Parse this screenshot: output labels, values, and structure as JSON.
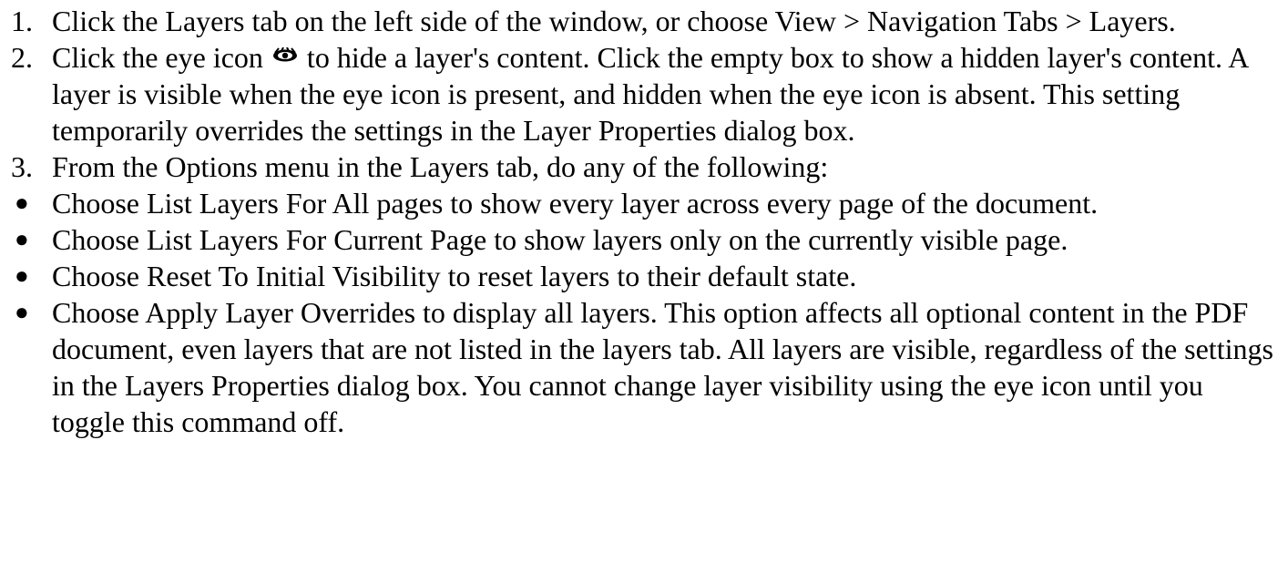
{
  "steps": [
    {
      "number": "1.",
      "text": "Click the Layers tab on the left side of the window, or choose View > Navigation Tabs > Layers."
    },
    {
      "number": "2.",
      "text_before_icon": "Click the eye icon",
      "icon": "eye-icon",
      "text_after_icon": " to hide a layer's content. Click the empty box to show a hidden layer's content. A layer is visible when the eye icon is present, and hidden when the eye icon is absent. This setting temporarily overrides the settings in the Layer Properties dialog box."
    },
    {
      "number": "3.",
      "text": "From the Options menu in the Layers tab, do any of the following:"
    }
  ],
  "bullets": [
    {
      "marker": "●",
      "text": "Choose List Layers For All pages to show every layer across every page of the document."
    },
    {
      "marker": "●",
      "text": "Choose List Layers For Current Page to show layers only on the currently visible page."
    },
    {
      "marker": "●",
      "text": "Choose Reset To Initial Visibility to reset layers to their default state."
    },
    {
      "marker": "●",
      "text": "Choose Apply Layer Overrides to display all layers. This option affects all optional content in the PDF document, even layers that are not listed in the layers tab. All layers are visible, regardless of the settings in the Layers Properties dialog box. You cannot change layer visibility using the eye icon until you toggle this command off."
    }
  ]
}
